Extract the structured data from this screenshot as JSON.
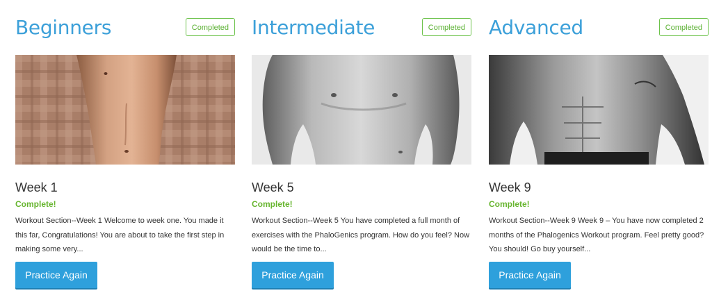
{
  "colors": {
    "title": "#3ca0d9",
    "badge_border": "#6cc24a",
    "status_green": "#67b52f",
    "button_bg": "#2ea0dc",
    "button_text": "#ffffff",
    "body_text": "#333333"
  },
  "cards": [
    {
      "level": "Beginners",
      "badge": "Completed",
      "image_icon": "torso-photo-beginner",
      "week": "Week 1",
      "status": "Complete!",
      "description": "Workout Section--Week 1 Welcome to week one. You made it this far, Congratulations! You are about to take the first step in making some very...",
      "button": "Practice Again"
    },
    {
      "level": "Intermediate",
      "badge": "Completed",
      "image_icon": "torso-photo-intermediate",
      "week": "Week 5",
      "status": "Complete!",
      "description": "Workout Section--Week 5 You have completed a full month of exercises with the PhaloGenics program. How do you feel? Now would be the time to...",
      "button": "Practice Again"
    },
    {
      "level": "Advanced",
      "badge": "Completed",
      "image_icon": "torso-photo-advanced",
      "week": "Week 9",
      "status": "Complete!",
      "description": "Workout Section--Week 9 Week 9 – You have now completed 2 months of the Phalogenics Workout program. Feel pretty good? You should! Go buy yourself...",
      "button": "Practice Again"
    }
  ]
}
